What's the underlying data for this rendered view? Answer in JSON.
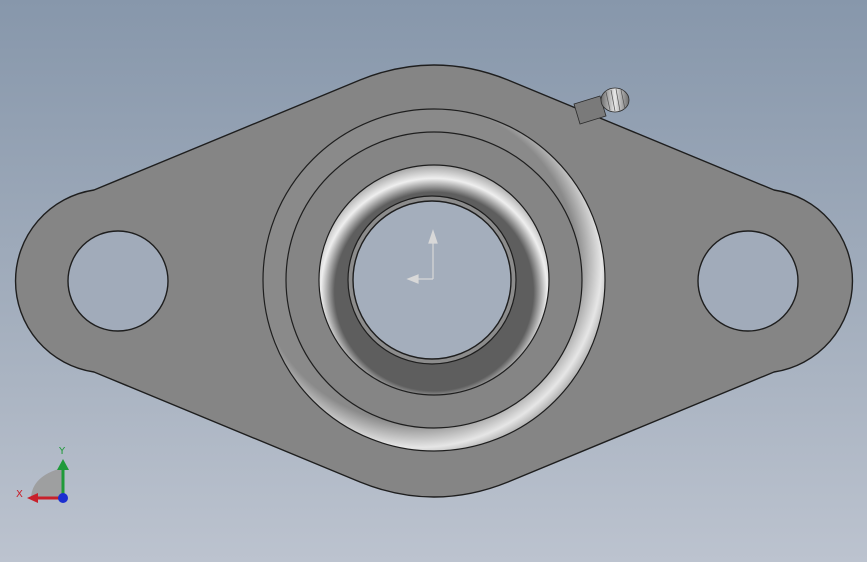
{
  "viewport": {
    "background_top": "#8797ab",
    "background_bottom": "#bcc3cf"
  },
  "model": {
    "part_color": "#858585",
    "edge_color": "#1e1e1e",
    "groove_highlight": "#e4e4e4"
  },
  "triad": {
    "x_label": "X",
    "y_label": "Y",
    "x_color": "#c8202a",
    "y_color": "#1f9a3a",
    "z_color": "#1c2fd0"
  }
}
